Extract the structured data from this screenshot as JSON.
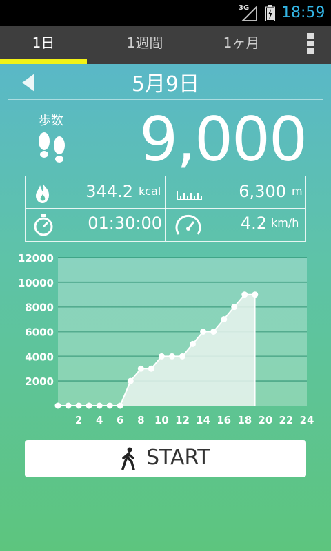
{
  "status_bar": {
    "network": "3G",
    "time": "18:59"
  },
  "tabs": [
    {
      "label": "1日",
      "active": true
    },
    {
      "label": "1週間",
      "active": false
    },
    {
      "label": "1ヶ月",
      "active": false
    }
  ],
  "header": {
    "date": "5月9日"
  },
  "steps": {
    "label": "歩数",
    "value": "9,000"
  },
  "stats": {
    "calories": {
      "value": "344.2",
      "unit": "kcal"
    },
    "distance": {
      "value": "6,300",
      "unit": "m"
    },
    "time": {
      "value": "01:30:00"
    },
    "speed": {
      "value": "4.2",
      "unit": "km/h"
    }
  },
  "chart_data": {
    "type": "area",
    "x": [
      0,
      1,
      2,
      3,
      4,
      5,
      6,
      7,
      8,
      9,
      10,
      11,
      12,
      13,
      14,
      15,
      16,
      17,
      18,
      19
    ],
    "values": [
      0,
      0,
      0,
      0,
      0,
      0,
      0,
      2000,
      3000,
      3000,
      4000,
      4000,
      4000,
      5000,
      6000,
      6000,
      7000,
      8000,
      9000,
      9000
    ],
    "xticks": [
      "2",
      "4",
      "6",
      "8",
      "10",
      "12",
      "14",
      "16",
      "18",
      "20",
      "22",
      "24"
    ],
    "yticks": [
      "2000",
      "4000",
      "6000",
      "8000",
      "10000",
      "12000"
    ],
    "xlim": [
      0,
      24
    ],
    "ylim": [
      0,
      12000
    ],
    "grid": true,
    "colors": {
      "fill": "#e9f3ef",
      "line": "#ffffff",
      "tick": "#ffffff"
    }
  },
  "start_button": {
    "label": "START"
  },
  "colors": {
    "accent": "#f2f217",
    "tab_bg": "#3e3e3e",
    "clock": "#33b5e5"
  }
}
